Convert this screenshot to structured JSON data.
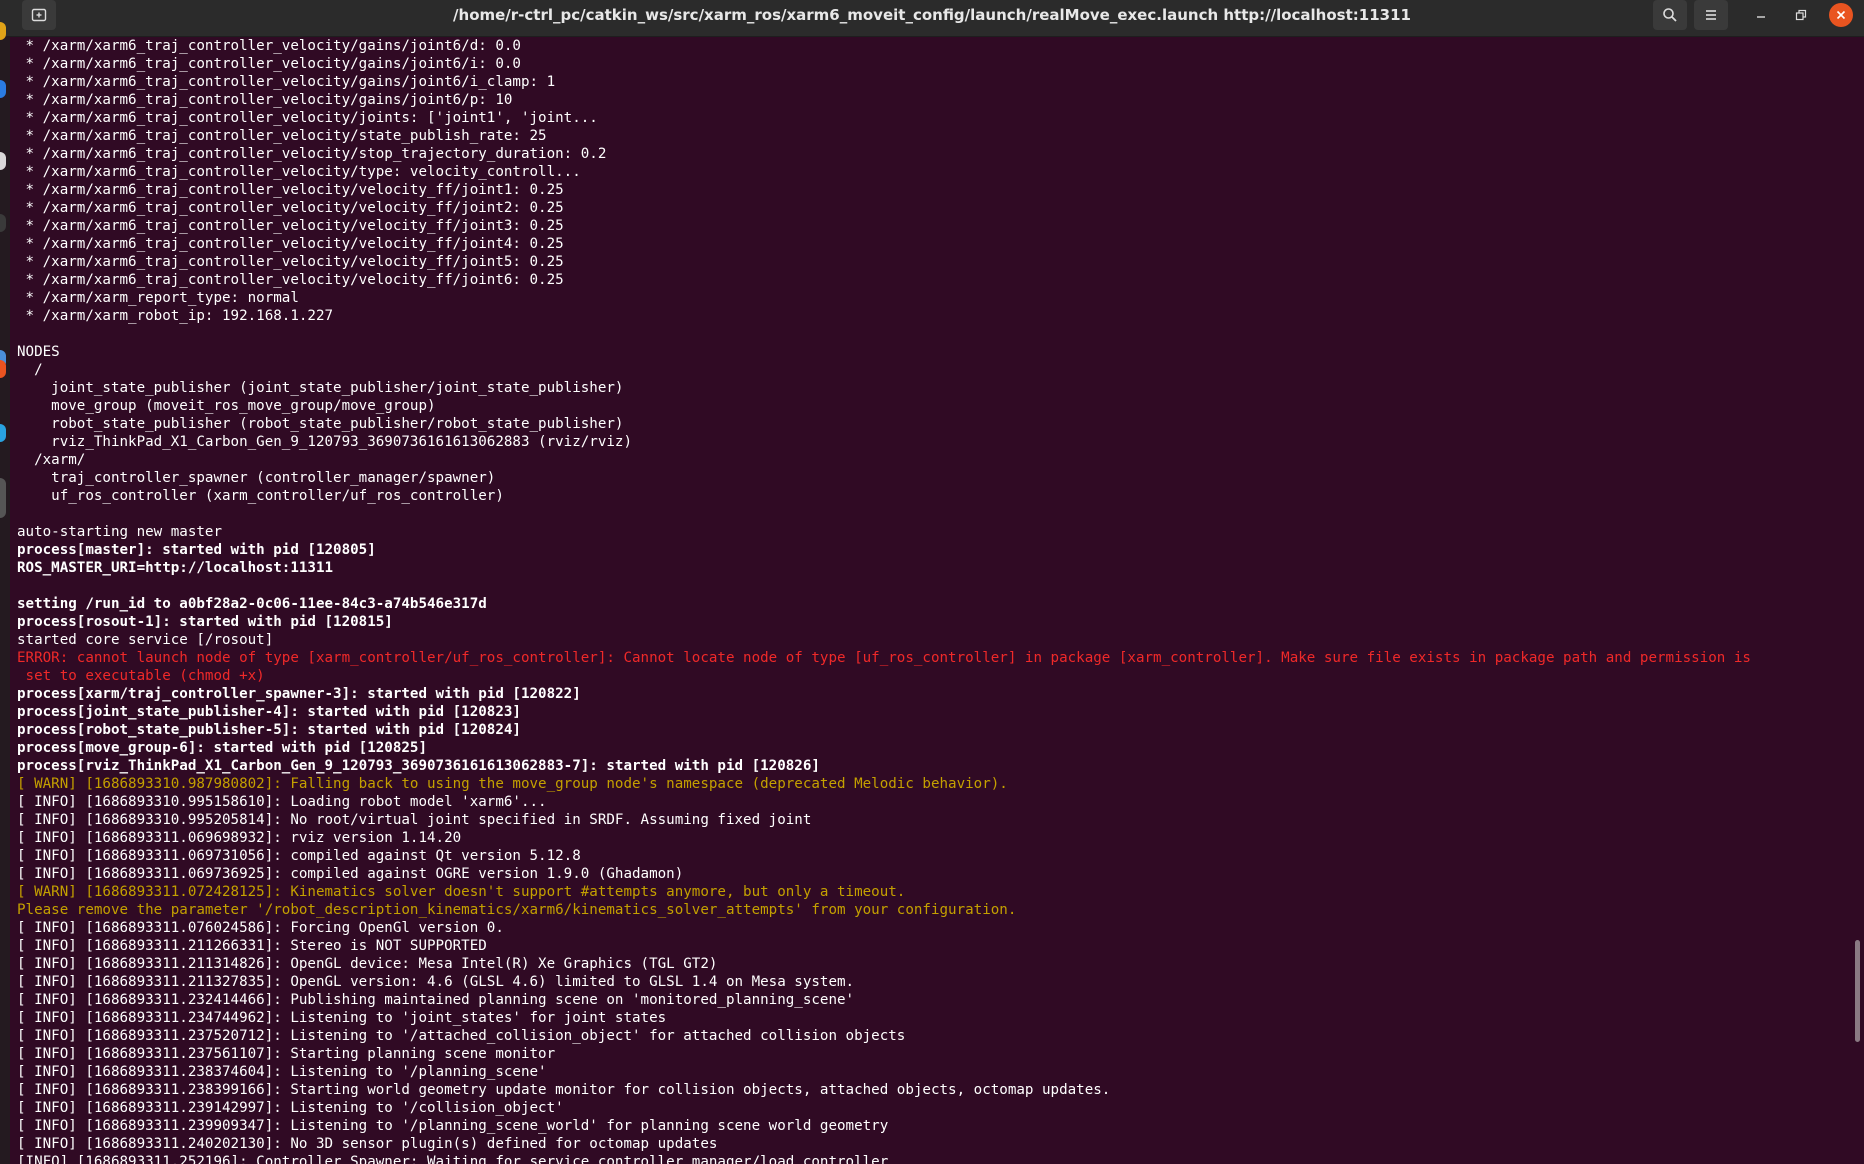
{
  "window": {
    "title": "/home/r-ctrl_pc/catkin_ws/src/xarm_ros/xarm6_moveit_config/launch/realMove_exec.launch http://localhost:11311"
  },
  "icons": {
    "new_tab": "new-tab-icon",
    "search": "search-icon",
    "menu": "hamburger-menu-icon",
    "minimize": "minimize-icon",
    "maximize": "maximize-icon",
    "close": "close-icon"
  },
  "colors": {
    "background": "#300a24",
    "error": "#ef2929",
    "warn": "#c4a000",
    "close_button": "#e95420"
  },
  "terminal": {
    "lines": [
      {
        "text": " * /xarm/xarm6_traj_controller_velocity/gains/joint6/d: 0.0",
        "style": "normal"
      },
      {
        "text": " * /xarm/xarm6_traj_controller_velocity/gains/joint6/i: 0.0",
        "style": "normal"
      },
      {
        "text": " * /xarm/xarm6_traj_controller_velocity/gains/joint6/i_clamp: 1",
        "style": "normal"
      },
      {
        "text": " * /xarm/xarm6_traj_controller_velocity/gains/joint6/p: 10",
        "style": "normal"
      },
      {
        "text": " * /xarm/xarm6_traj_controller_velocity/joints: ['joint1', 'joint...",
        "style": "normal"
      },
      {
        "text": " * /xarm/xarm6_traj_controller_velocity/state_publish_rate: 25",
        "style": "normal"
      },
      {
        "text": " * /xarm/xarm6_traj_controller_velocity/stop_trajectory_duration: 0.2",
        "style": "normal"
      },
      {
        "text": " * /xarm/xarm6_traj_controller_velocity/type: velocity_controll...",
        "style": "normal"
      },
      {
        "text": " * /xarm/xarm6_traj_controller_velocity/velocity_ff/joint1: 0.25",
        "style": "normal"
      },
      {
        "text": " * /xarm/xarm6_traj_controller_velocity/velocity_ff/joint2: 0.25",
        "style": "normal"
      },
      {
        "text": " * /xarm/xarm6_traj_controller_velocity/velocity_ff/joint3: 0.25",
        "style": "normal"
      },
      {
        "text": " * /xarm/xarm6_traj_controller_velocity/velocity_ff/joint4: 0.25",
        "style": "normal"
      },
      {
        "text": " * /xarm/xarm6_traj_controller_velocity/velocity_ff/joint5: 0.25",
        "style": "normal"
      },
      {
        "text": " * /xarm/xarm6_traj_controller_velocity/velocity_ff/joint6: 0.25",
        "style": "normal"
      },
      {
        "text": " * /xarm/xarm_report_type: normal",
        "style": "normal"
      },
      {
        "text": " * /xarm/xarm_robot_ip: 192.168.1.227",
        "style": "normal"
      },
      {
        "text": "",
        "style": "normal"
      },
      {
        "text": "NODES",
        "style": "normal"
      },
      {
        "text": "  /",
        "style": "normal"
      },
      {
        "text": "    joint_state_publisher (joint_state_publisher/joint_state_publisher)",
        "style": "normal"
      },
      {
        "text": "    move_group (moveit_ros_move_group/move_group)",
        "style": "normal"
      },
      {
        "text": "    robot_state_publisher (robot_state_publisher/robot_state_publisher)",
        "style": "normal"
      },
      {
        "text": "    rviz_ThinkPad_X1_Carbon_Gen_9_120793_3690736161613062883 (rviz/rviz)",
        "style": "normal"
      },
      {
        "text": "  /xarm/",
        "style": "normal"
      },
      {
        "text": "    traj_controller_spawner (controller_manager/spawner)",
        "style": "normal"
      },
      {
        "text": "    uf_ros_controller (xarm_controller/uf_ros_controller)",
        "style": "normal"
      },
      {
        "text": "",
        "style": "normal"
      },
      {
        "text": "auto-starting new master",
        "style": "normal"
      },
      {
        "text": "process[master]: started with pid [120805]",
        "style": "bold"
      },
      {
        "text": "ROS_MASTER_URI=http://localhost:11311",
        "style": "bold"
      },
      {
        "text": "",
        "style": "normal"
      },
      {
        "text": "setting /run_id to a0bf28a2-0c06-11ee-84c3-a74b546e317d",
        "style": "bold"
      },
      {
        "text": "process[rosout-1]: started with pid [120815]",
        "style": "bold"
      },
      {
        "text": "started core service [/rosout]",
        "style": "normal"
      },
      {
        "text": "ERROR: cannot launch node of type [xarm_controller/uf_ros_controller]: Cannot locate node of type [uf_ros_controller] in package [xarm_controller]. Make sure file exists in package path and permission is",
        "style": "error"
      },
      {
        "text": " set to executable (chmod +x)",
        "style": "error"
      },
      {
        "text": "process[xarm/traj_controller_spawner-3]: started with pid [120822]",
        "style": "bold"
      },
      {
        "text": "process[joint_state_publisher-4]: started with pid [120823]",
        "style": "bold"
      },
      {
        "text": "process[robot_state_publisher-5]: started with pid [120824]",
        "style": "bold"
      },
      {
        "text": "process[move_group-6]: started with pid [120825]",
        "style": "bold"
      },
      {
        "text": "process[rviz_ThinkPad_X1_Carbon_Gen_9_120793_3690736161613062883-7]: started with pid [120826]",
        "style": "bold"
      },
      {
        "text": "[ WARN] [1686893310.987980802]: Falling back to using the move_group node's namespace (deprecated Melodic behavior).",
        "style": "warn"
      },
      {
        "text": "[ INFO] [1686893310.995158610]: Loading robot model 'xarm6'...",
        "style": "normal"
      },
      {
        "text": "[ INFO] [1686893310.995205814]: No root/virtual joint specified in SRDF. Assuming fixed joint",
        "style": "normal"
      },
      {
        "text": "[ INFO] [1686893311.069698932]: rviz version 1.14.20",
        "style": "normal"
      },
      {
        "text": "[ INFO] [1686893311.069731056]: compiled against Qt version 5.12.8",
        "style": "normal"
      },
      {
        "text": "[ INFO] [1686893311.069736925]: compiled against OGRE version 1.9.0 (Ghadamon)",
        "style": "normal"
      },
      {
        "text": "[ WARN] [1686893311.072428125]: Kinematics solver doesn't support #attempts anymore, but only a timeout.",
        "style": "warn"
      },
      {
        "text": "Please remove the parameter '/robot_description_kinematics/xarm6/kinematics_solver_attempts' from your configuration.",
        "style": "warn"
      },
      {
        "text": "[ INFO] [1686893311.076024586]: Forcing OpenGl version 0.",
        "style": "normal"
      },
      {
        "text": "[ INFO] [1686893311.211266331]: Stereo is NOT SUPPORTED",
        "style": "normal"
      },
      {
        "text": "[ INFO] [1686893311.211314826]: OpenGL device: Mesa Intel(R) Xe Graphics (TGL GT2)",
        "style": "normal"
      },
      {
        "text": "[ INFO] [1686893311.211327835]: OpenGL version: 4.6 (GLSL 4.6) limited to GLSL 1.4 on Mesa system.",
        "style": "normal"
      },
      {
        "text": "[ INFO] [1686893311.232414466]: Publishing maintained planning scene on 'monitored_planning_scene'",
        "style": "normal"
      },
      {
        "text": "[ INFO] [1686893311.234744962]: Listening to 'joint_states' for joint states",
        "style": "normal"
      },
      {
        "text": "[ INFO] [1686893311.237520712]: Listening to '/attached_collision_object' for attached collision objects",
        "style": "normal"
      },
      {
        "text": "[ INFO] [1686893311.237561107]: Starting planning scene monitor",
        "style": "normal"
      },
      {
        "text": "[ INFO] [1686893311.238374604]: Listening to '/planning_scene'",
        "style": "normal"
      },
      {
        "text": "[ INFO] [1686893311.238399166]: Starting world geometry update monitor for collision objects, attached objects, octomap updates.",
        "style": "normal"
      },
      {
        "text": "[ INFO] [1686893311.239142997]: Listening to '/collision_object'",
        "style": "normal"
      },
      {
        "text": "[ INFO] [1686893311.239909347]: Listening to '/planning_scene_world' for planning scene world geometry",
        "style": "normal"
      },
      {
        "text": "[ INFO] [1686893311.240202130]: No 3D sensor plugin(s) defined for octomap updates",
        "style": "normal"
      },
      {
        "text": "[INFO] [1686893311.252196]: Controller Spawner: Waiting for service controller_manager/load_controller",
        "style": "normal"
      }
    ]
  }
}
